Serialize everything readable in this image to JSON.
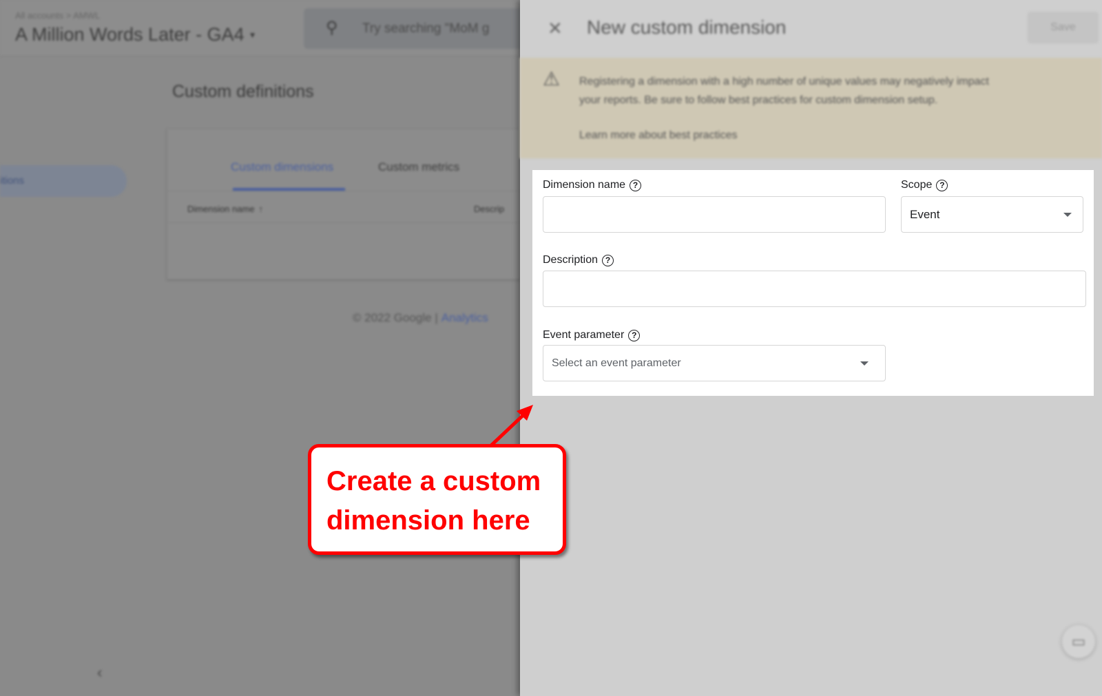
{
  "background": {
    "breadcrumb": "All accounts > AMWL",
    "property_title": "A Million Words Later - GA4",
    "search_placeholder": "Try searching \"MoM g",
    "page_title": "Custom definitions",
    "sidebar_active_item": "itions",
    "tabs": [
      {
        "label": "Custom dimensions",
        "active": true
      },
      {
        "label": "Custom metrics",
        "active": false
      }
    ],
    "table_headers": [
      "Dimension name",
      "Descrip"
    ],
    "footer_copyright": "© 2022 Google |",
    "footer_link": "Analytics"
  },
  "panel": {
    "title": "New custom dimension",
    "save_label": "Save",
    "warning_text_1": "Registering a dimension with a high number of unique values may negatively impact",
    "warning_text_2": "your reports. Be sure to follow best practices for custom dimension setup.",
    "warning_link": "Learn more about best practices",
    "form": {
      "dimension_name_label": "Dimension name",
      "dimension_name_value": "",
      "scope_label": "Scope",
      "scope_value": "Event",
      "description_label": "Description",
      "description_value": "",
      "event_parameter_label": "Event parameter",
      "event_parameter_placeholder": "Select an event parameter"
    }
  },
  "annotation": {
    "line1": "Create a custom",
    "line2": "dimension here",
    "color": "#ff0000"
  },
  "colors": {
    "accent": "#4a5f9e",
    "warning_bg": "#cfc8b4"
  }
}
